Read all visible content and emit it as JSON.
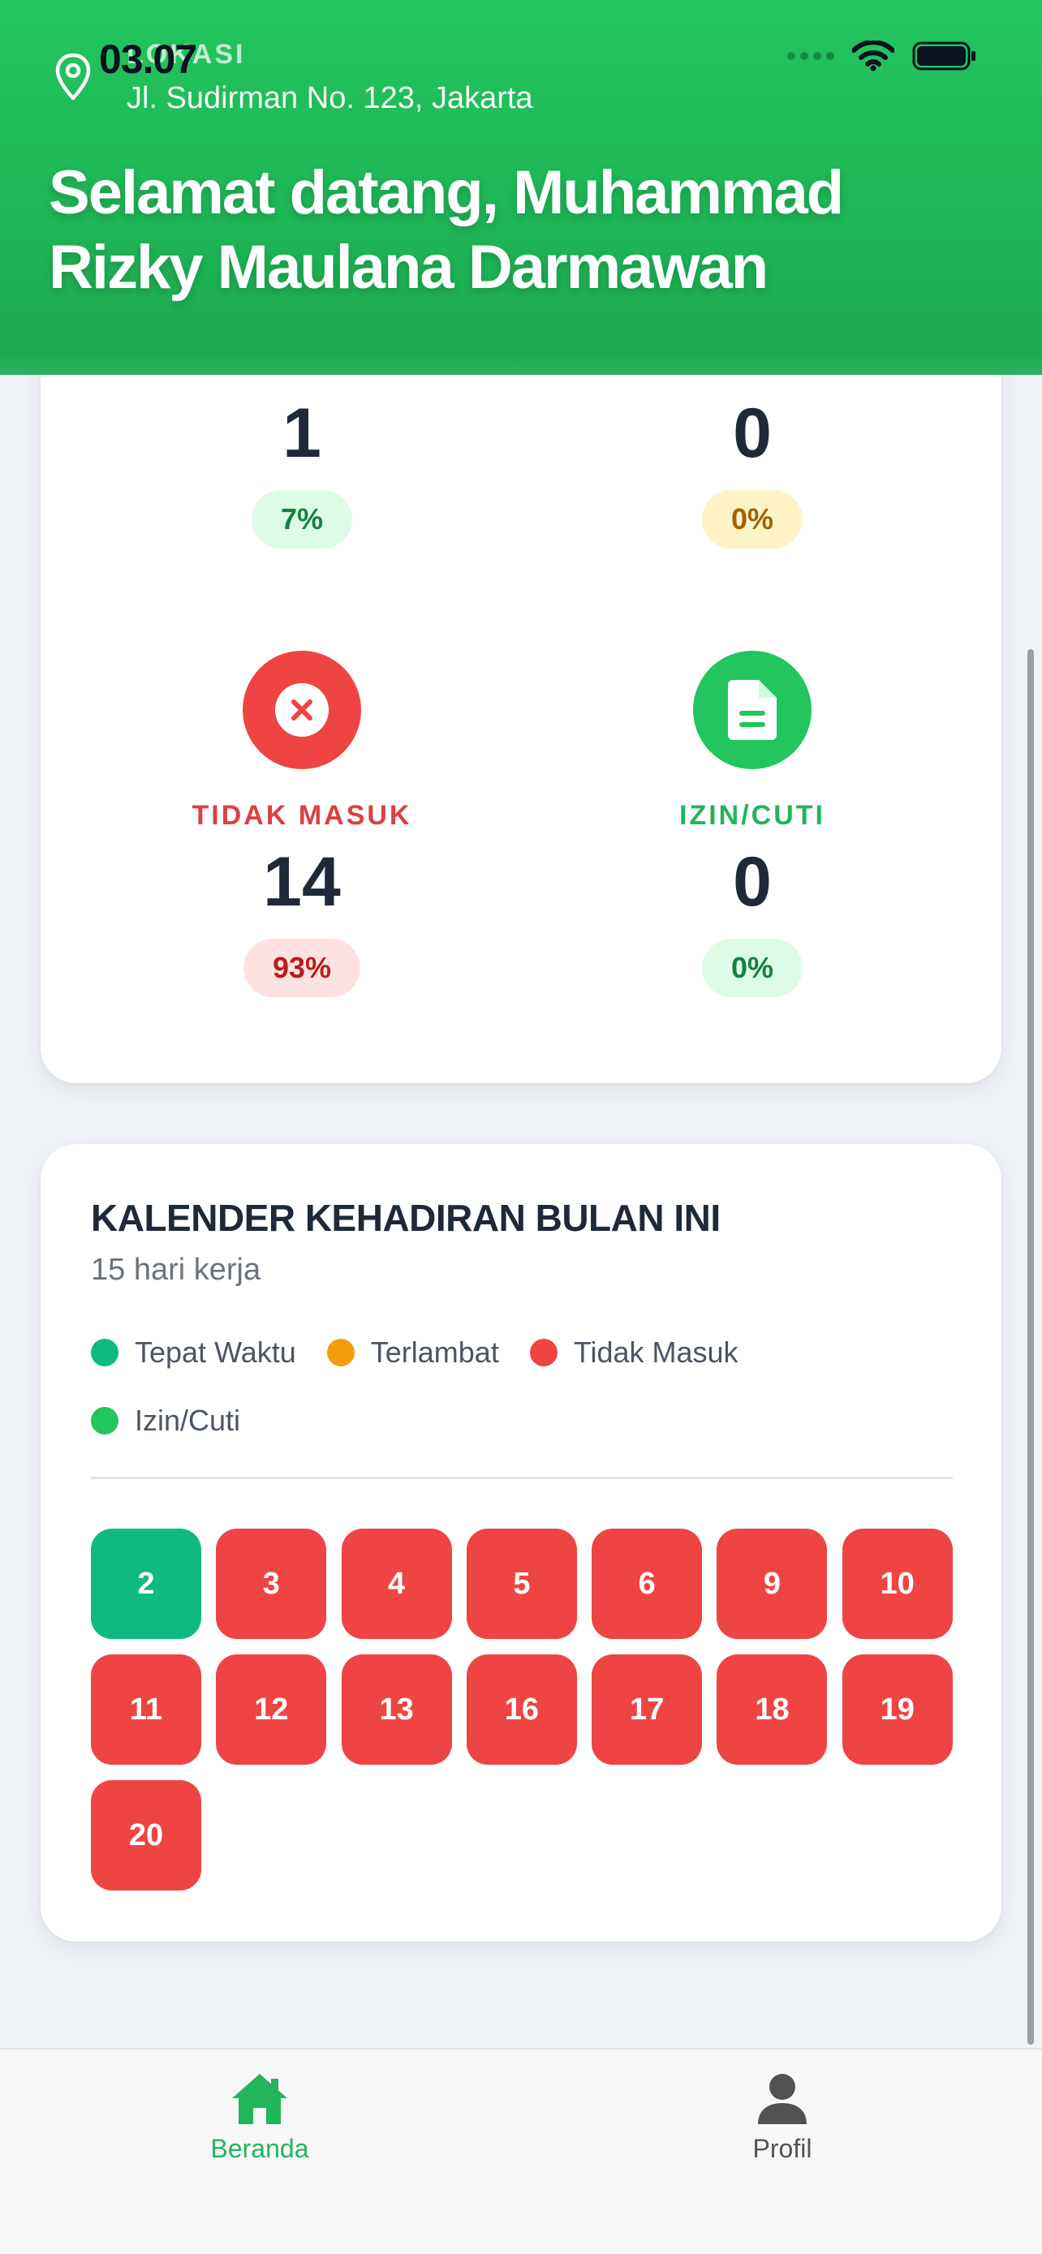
{
  "status_bar": {
    "time": "03.07"
  },
  "header": {
    "location_label": "LOKASI",
    "location_address": "Jl. Sudirman No. 123, Jakarta",
    "welcome_text": "Selamat datang, Muhammad Rizky Maulana Darmawan"
  },
  "stats": {
    "top": [
      {
        "value": "1",
        "percent": "7%"
      },
      {
        "value": "0",
        "percent": "0%"
      }
    ],
    "bottom": [
      {
        "label": "TIDAK MASUK",
        "value": "14",
        "percent": "93%",
        "icon": "x-icon"
      },
      {
        "label": "IZIN/CUTI",
        "value": "0",
        "percent": "0%",
        "icon": "document-icon"
      }
    ]
  },
  "calendar": {
    "title": "KALENDER KEHADIRAN BULAN INI",
    "subtitle": "15 hari kerja",
    "legend": [
      {
        "label": "Tepat Waktu",
        "color": "#10b981"
      },
      {
        "label": "Terlambat",
        "color": "#f59e0b"
      },
      {
        "label": "Tidak Masuk",
        "color": "#ef4444"
      },
      {
        "label": "Izin/Cuti",
        "color": "#22c55e"
      }
    ],
    "days": [
      {
        "day": "2",
        "status": "ontime"
      },
      {
        "day": "3",
        "status": "absent"
      },
      {
        "day": "4",
        "status": "absent"
      },
      {
        "day": "5",
        "status": "absent"
      },
      {
        "day": "6",
        "status": "absent"
      },
      {
        "day": "9",
        "status": "absent"
      },
      {
        "day": "10",
        "status": "absent"
      },
      {
        "day": "11",
        "status": "absent"
      },
      {
        "day": "12",
        "status": "absent"
      },
      {
        "day": "13",
        "status": "absent"
      },
      {
        "day": "16",
        "status": "absent"
      },
      {
        "day": "17",
        "status": "absent"
      },
      {
        "day": "18",
        "status": "absent"
      },
      {
        "day": "19",
        "status": "absent"
      },
      {
        "day": "20",
        "status": "absent"
      }
    ]
  },
  "nav": {
    "items": [
      {
        "label": "Beranda",
        "icon": "home-icon",
        "active": true
      },
      {
        "label": "Profil",
        "icon": "person-icon",
        "active": false
      }
    ]
  },
  "colors": {
    "brand": "#22c55e",
    "absent": "#ef4444",
    "ontime": "#10b981",
    "late": "#f59e0b"
  }
}
